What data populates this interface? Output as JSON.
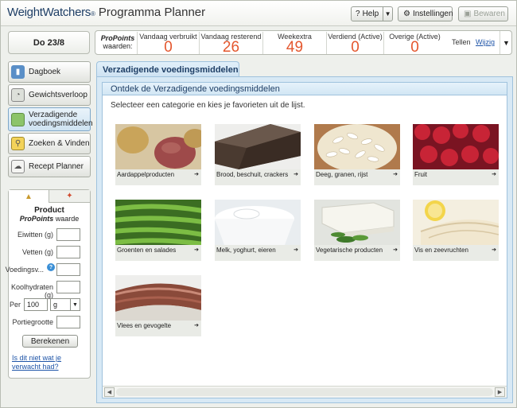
{
  "header": {
    "brand": "WeightWatchers",
    "brand_reg": "®",
    "app_title": "Programma Planner",
    "help_label": "Help",
    "settings_label": "Instellingen",
    "save_label": "Bewaren"
  },
  "date_label": "Do 23/8",
  "points": {
    "label_brand": "ProPoints",
    "label_rest": "waarden:",
    "columns": [
      {
        "title": "Vandaag verbruikt",
        "value": "0"
      },
      {
        "title": "Vandaag resterend",
        "value": "26"
      },
      {
        "title": "Weekextra",
        "value": "49"
      },
      {
        "title": "Verdiend (Active)",
        "value": "0"
      },
      {
        "title": "Overige (Active)",
        "value": "0"
      }
    ],
    "tellen_label": "Tellen",
    "wijzig_label": "Wijzig",
    "value_color": "#e4572e"
  },
  "nav": [
    {
      "label": "Dagboek",
      "icon": "diary-book-icon"
    },
    {
      "label": "Gewichtsverloop",
      "icon": "scale-icon"
    },
    {
      "label": "Verzadigende voedingsmiddelen",
      "icon": "green-food-icon"
    },
    {
      "label": "Zoeken & Vinden",
      "icon": "magnifier-icon"
    },
    {
      "label": "Recept Planner",
      "icon": "chef-hat-icon"
    }
  ],
  "calc": {
    "title": "Product",
    "subtitle_brand": "ProPoints",
    "subtitle_rest": "waarde",
    "fields": [
      {
        "label": "Eiwitten (g)"
      },
      {
        "label": "Vetten (g)"
      },
      {
        "label": "Voedingsv..."
      },
      {
        "label": "Koolhydraten (g)"
      }
    ],
    "per_label": "Per",
    "per_amount": "100",
    "per_unit": "g",
    "portion_label": "Portiegrootte",
    "calc_button": "Berekenen",
    "help_link": "Is dit niet wat je verwacht had?"
  },
  "main": {
    "tab_label": "Verzadigende voedingsmiddelen",
    "panel_title": "Ontdek de Verzadigende voedingsmiddelen",
    "intro": "Selecteer een categorie en kies je favorieten uit de lijst.",
    "categories": [
      {
        "label": "Aardappelproducten",
        "icon": "potato-icon"
      },
      {
        "label": "Brood, beschuit, crackers",
        "icon": "bread-icon"
      },
      {
        "label": "Deeg, granen, rijst",
        "icon": "pasta-icon"
      },
      {
        "label": "Fruit",
        "icon": "raspberry-icon"
      },
      {
        "label": "Groenten en salades",
        "icon": "green-beans-icon"
      },
      {
        "label": "Melk, yoghurt, eieren",
        "icon": "yoghurt-icon"
      },
      {
        "label": "Vegetarische producten",
        "icon": "tofu-icon"
      },
      {
        "label": "Vis en zeevruchten",
        "icon": "fish-icon"
      },
      {
        "label": "Vlees en gevogelte",
        "icon": "meat-icon"
      }
    ]
  }
}
